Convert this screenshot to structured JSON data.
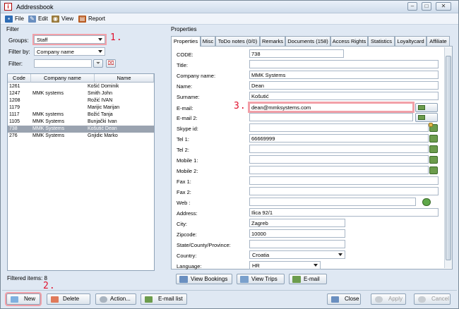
{
  "window": {
    "title": "Addressbook"
  },
  "menu": [
    {
      "label": "File",
      "icon": "file-icon",
      "color": "#2f6db5"
    },
    {
      "label": "Edit",
      "icon": "edit-icon",
      "color": "#6a8fc0"
    },
    {
      "label": "View",
      "icon": "view-icon",
      "color": "#9a7a3a"
    },
    {
      "label": "Report",
      "icon": "report-icon",
      "color": "#b85a20"
    }
  ],
  "filter": {
    "section_label": "Filter",
    "groups_label": "Groups:",
    "groups_value": "Staff",
    "filter_by_label": "Filter by:",
    "filter_by_value": "Company name",
    "filter_label": "Filter:",
    "filter_value": ""
  },
  "grid": {
    "columns": [
      "Code",
      "Company name",
      "Name"
    ],
    "rows": [
      {
        "code": "1261",
        "company": "",
        "name": "Košić Dominik"
      },
      {
        "code": "1247",
        "company": "MMK systems",
        "name": "Smith John"
      },
      {
        "code": "1208",
        "company": "",
        "name": "Rožić IVAN"
      },
      {
        "code": "1179",
        "company": "",
        "name": "Marijic Marijan"
      },
      {
        "code": "1117",
        "company": "MMK systems",
        "name": "Božić Tanja"
      },
      {
        "code": "1105",
        "company": "MMK Systems",
        "name": "Bunjački Ivan"
      },
      {
        "code": "738",
        "company": "MMK Systems",
        "name": "Košutić Dean"
      },
      {
        "code": "276",
        "company": "MMK Systems",
        "name": "Gnjidic Marko"
      }
    ],
    "selected_index": 6
  },
  "filtered_items_label": "Filtered items:",
  "filtered_items_count": "8",
  "annotations": {
    "one": "1.",
    "two": "2.",
    "three": "3."
  },
  "properties": {
    "section_label": "Properties",
    "tabs": [
      "Properties",
      "Misc",
      "ToDo notes (0/0)",
      "Remarks",
      "Documents (158)",
      "Access Rights",
      "Statistics",
      "Loyaltycard",
      "Affiliate"
    ],
    "active_tab": 0,
    "fields": [
      {
        "label": "CODE:",
        "value": "738"
      },
      {
        "label": "Title:",
        "value": ""
      },
      {
        "label": "Company name:",
        "value": "MMK Systems"
      },
      {
        "label": "Name:",
        "value": "Dean"
      },
      {
        "label": "Surname:",
        "value": "Košutić"
      },
      {
        "label": "E-mail:",
        "value": "dean@mmksystems.com"
      },
      {
        "label": "E-mail 2:",
        "value": ""
      },
      {
        "label": "Skype id:",
        "value": ""
      },
      {
        "label": "Tel 1:",
        "value": "66669999"
      },
      {
        "label": "Tel 2:",
        "value": ""
      },
      {
        "label": "Mobile 1:",
        "value": ""
      },
      {
        "label": "Mobile 2:",
        "value": ""
      },
      {
        "label": "Fax 1:",
        "value": ""
      },
      {
        "label": "Fax 2:",
        "value": ""
      },
      {
        "label": "Web :",
        "value": ""
      },
      {
        "label": "Address:",
        "value": "Ilica 92/1"
      },
      {
        "label": "City:",
        "value": "Zagreb"
      },
      {
        "label": "Zipcode:",
        "value": "10000"
      },
      {
        "label": "State/County/Province:",
        "value": ""
      },
      {
        "label": "Country:",
        "value": "Croatia"
      },
      {
        "label": "Language:",
        "value": "HR"
      }
    ],
    "buttons": {
      "bookings": "View Bookings",
      "trips": "View Trips",
      "email": "E-mail"
    }
  },
  "bottom": {
    "new": "New",
    "delete": "Delete",
    "action": "Action...",
    "email_list": "E-mail list",
    "close": "Close",
    "apply": "Apply",
    "cancel": "Cancel"
  },
  "colors": {
    "highlight": "#f2a0a8",
    "annotation": "#e0102c",
    "selected_row": "#9aa3b0"
  }
}
